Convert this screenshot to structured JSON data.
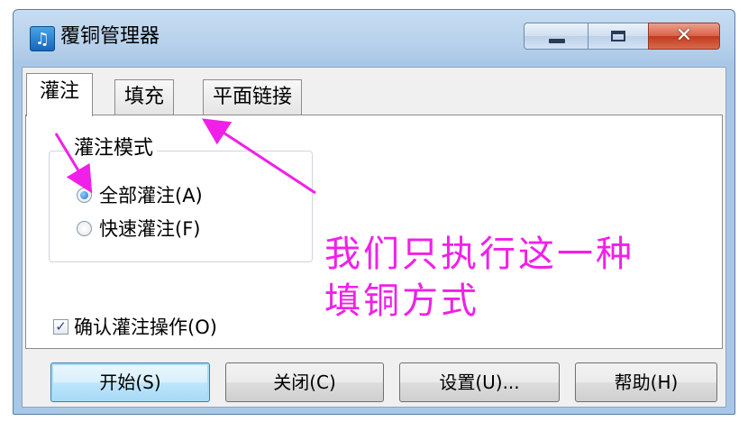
{
  "window": {
    "title": "覆铜管理器",
    "icon": "app-icon",
    "app_icon_glyph": "♫",
    "controls": {
      "minimize_icon": "minimize-icon",
      "maximize_icon": "maximize-icon",
      "close_icon": "close-icon",
      "close_glyph": "✕"
    }
  },
  "tabs": [
    {
      "label": "灌注",
      "active": true
    },
    {
      "label": "填充",
      "active": false
    },
    {
      "label": "平面链接",
      "active": false
    }
  ],
  "fill_mode_group": {
    "legend": "灌注模式",
    "options": [
      {
        "label": "全部灌注(A)",
        "checked": true
      },
      {
        "label": "快速灌注(F)",
        "checked": false
      }
    ]
  },
  "confirm_checkbox": {
    "label": "确认灌注操作(O)",
    "checked": true,
    "check_glyph": "✓"
  },
  "annotation": {
    "lines": [
      "我们只执行这一种",
      "填铜方式"
    ],
    "color": "#f020e8"
  },
  "buttons": {
    "start": "开始(S)",
    "close": "关闭(C)",
    "settings": "设置(U)...",
    "help": "帮助(H)"
  },
  "colors": {
    "title_bar": "#b7d1ec",
    "close_button": "#c3391d",
    "default_button_border": "#3c7fb1",
    "annotation_arrow": "#f020e8"
  }
}
